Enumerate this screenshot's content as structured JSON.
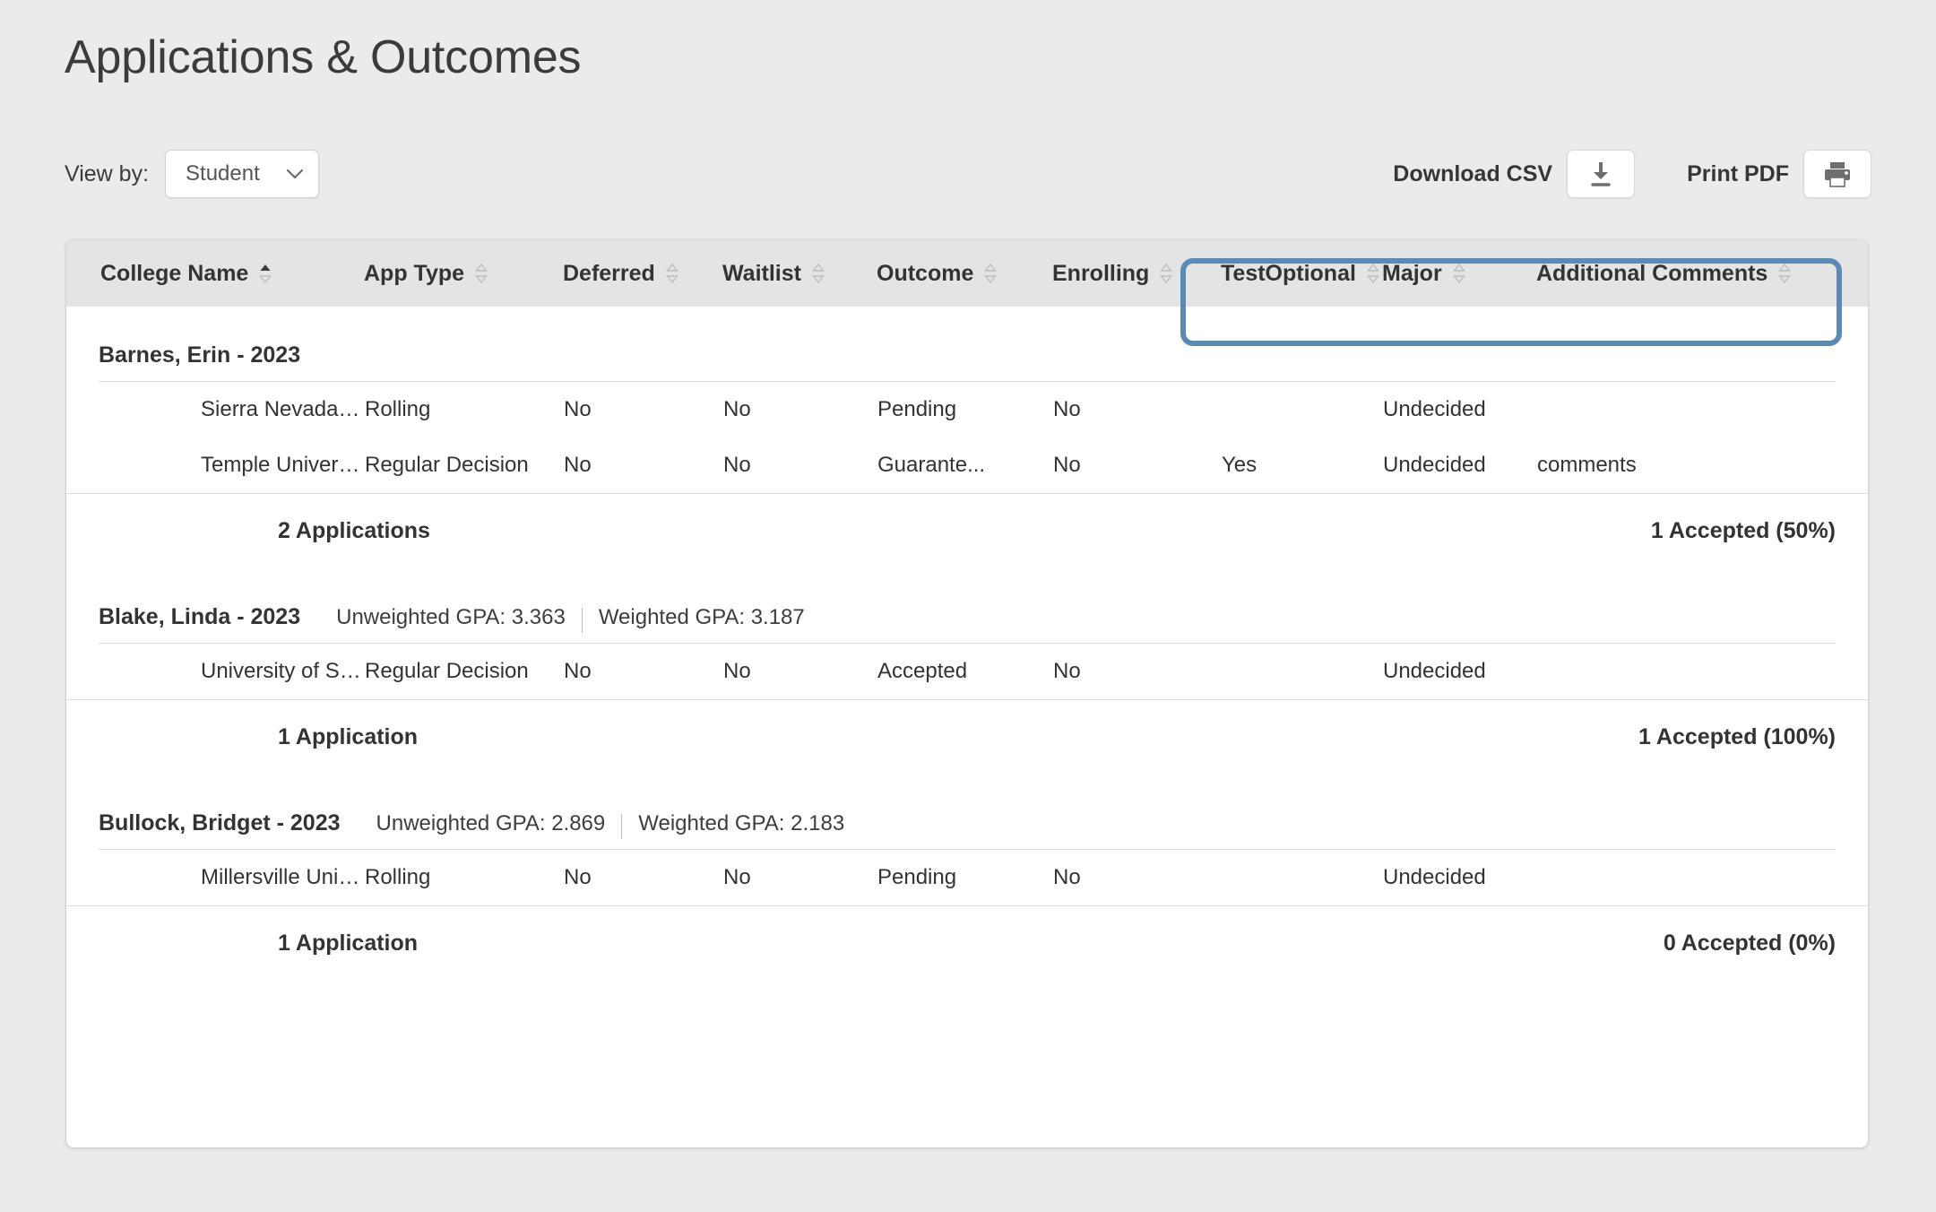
{
  "page": {
    "title": "Applications & Outcomes"
  },
  "toolbar": {
    "view_by_label": "View by:",
    "view_by_value": "Student",
    "view_by_options": [
      "Student"
    ],
    "download_csv_label": "Download CSV",
    "download_icon": "download-icon",
    "print_pdf_label": "Print PDF",
    "print_icon": "printer-icon"
  },
  "table": {
    "columns": [
      {
        "label": "College Name",
        "sort": "asc"
      },
      {
        "label": "App Type",
        "sort": "none"
      },
      {
        "label": "Deferred",
        "sort": "none"
      },
      {
        "label": "Waitlist",
        "sort": "none"
      },
      {
        "label": "Outcome",
        "sort": "none"
      },
      {
        "label": "Enrolling",
        "sort": "none"
      },
      {
        "label": "TestOptional",
        "sort": "none"
      },
      {
        "label": "Major",
        "sort": "none"
      },
      {
        "label": "Additional Comments",
        "sort": "none"
      }
    ],
    "groups": [
      {
        "name": "Barnes, Erin - 2023",
        "unweighted_gpa": "",
        "weighted_gpa": "",
        "rows": [
          {
            "college": "Sierra Nevada College",
            "app_type": "Rolling",
            "deferred": "No",
            "waitlist": "No",
            "outcome": "Pending",
            "enrolling": "No",
            "test_optional": "",
            "major": "Undecided",
            "comments": ""
          },
          {
            "college": "Temple University",
            "app_type": "Regular Decision",
            "deferred": "No",
            "waitlist": "No",
            "outcome": "Guarante...",
            "enrolling": "No",
            "test_optional": "Yes",
            "major": "Undecided",
            "comments": "comments"
          }
        ],
        "summary_left": "2 Applications",
        "summary_right": "1 Accepted (50%)"
      },
      {
        "name": "Blake, Linda - 2023",
        "unweighted_gpa": "Unweighted GPA: 3.363",
        "weighted_gpa": "Weighted GPA: 3.187",
        "rows": [
          {
            "college": "University of South C...",
            "app_type": "Regular Decision",
            "deferred": "No",
            "waitlist": "No",
            "outcome": "Accepted",
            "enrolling": "No",
            "test_optional": "",
            "major": "Undecided",
            "comments": ""
          }
        ],
        "summary_left": "1 Application",
        "summary_right": "1 Accepted (100%)"
      },
      {
        "name": "Bullock, Bridget - 2023",
        "unweighted_gpa": "Unweighted GPA: 2.869",
        "weighted_gpa": "Weighted GPA: 2.183",
        "rows": [
          {
            "college": "Millersville University...",
            "app_type": "Rolling",
            "deferred": "No",
            "waitlist": "No",
            "outcome": "Pending",
            "enrolling": "No",
            "test_optional": "",
            "major": "Undecided",
            "comments": ""
          }
        ],
        "summary_left": "1 Application",
        "summary_right": "0 Accepted (0%)"
      }
    ]
  },
  "annotation": {
    "highlight_color": "#5b8ab4",
    "highlight_target": "TestOptional, Major, Additional Comments columns"
  },
  "colors": {
    "page_background": "#ebebeb",
    "card_background": "#ffffff",
    "header_row": "#e4e4e4",
    "text": "#333333",
    "rule": "#dcdcdc"
  }
}
